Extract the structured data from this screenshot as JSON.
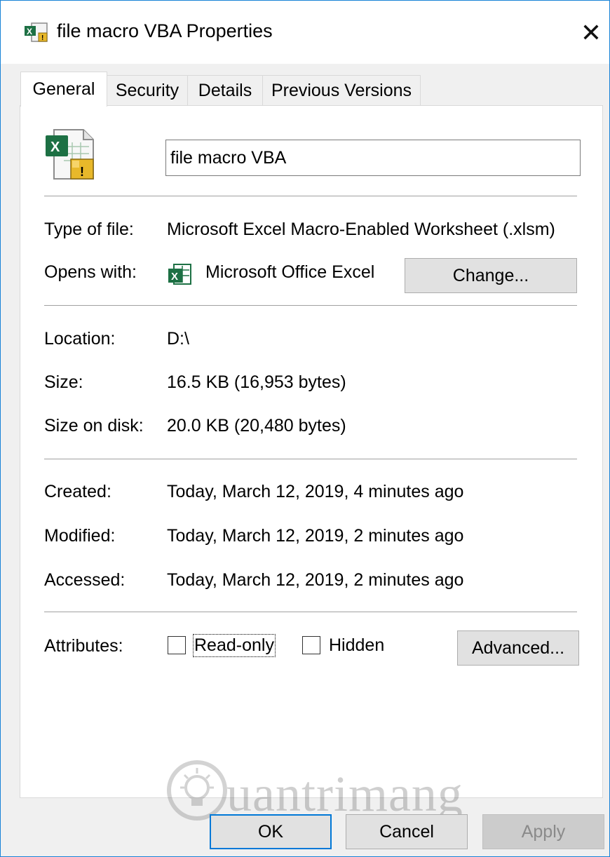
{
  "window": {
    "title": "file macro VBA Properties",
    "close_glyph": "✕"
  },
  "tabs": [
    {
      "label": "General",
      "active": true
    },
    {
      "label": "Security",
      "active": false
    },
    {
      "label": "Details",
      "active": false
    },
    {
      "label": "Previous Versions",
      "active": false
    }
  ],
  "general": {
    "file_icon": "excel-macro-file-icon",
    "file_name": "file macro VBA",
    "type_label": "Type of file:",
    "type_value": "Microsoft Excel Macro-Enabled Worksheet (.xlsm)",
    "opens_label": "Opens with:",
    "opens_app_icon": "excel-app-icon",
    "opens_value": "Microsoft Office Excel",
    "change_label": "Change...",
    "location_label": "Location:",
    "location_value": "D:\\",
    "size_label": "Size:",
    "size_value": "16.5 KB (16,953 bytes)",
    "size_disk_label": "Size on disk:",
    "size_disk_value": "20.0 KB (20,480 bytes)",
    "created_label": "Created:",
    "created_value": "Today, March 12, 2019, 4 minutes ago",
    "modified_label": "Modified:",
    "modified_value": "Today, March 12, 2019, 2 minutes ago",
    "accessed_label": "Accessed:",
    "accessed_value": "Today, March 12, 2019, 2 minutes ago",
    "attributes_label": "Attributes:",
    "readonly_label": "Read-only",
    "readonly_checked": false,
    "hidden_label": "Hidden",
    "hidden_checked": false,
    "advanced_label": "Advanced..."
  },
  "footer": {
    "ok_label": "OK",
    "cancel_label": "Cancel",
    "apply_label": "Apply"
  },
  "watermark": {
    "text": "uantrimang",
    "icon": "lightbulb-icon"
  },
  "colors": {
    "accent": "#0078d7",
    "excel_green": "#1d7044",
    "warning_yellow": "#e8b82a"
  }
}
